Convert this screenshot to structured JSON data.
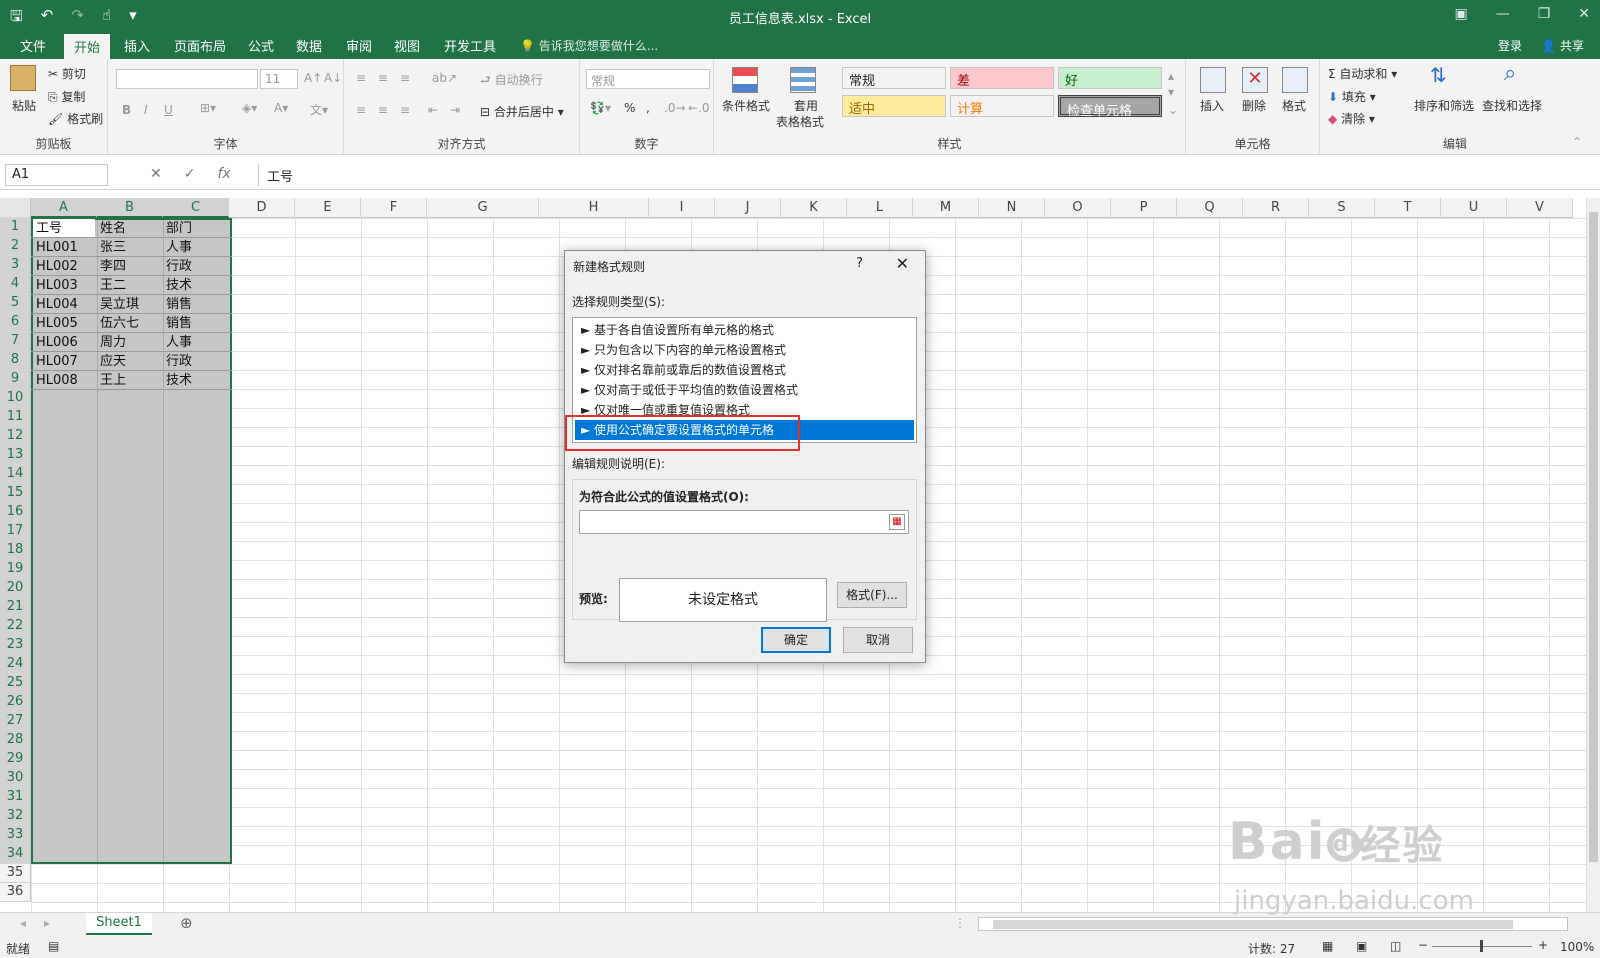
{
  "window": {
    "title": "员工信息表.xlsx - Excel"
  },
  "tabs": [
    "文件",
    "开始",
    "插入",
    "页面布局",
    "公式",
    "数据",
    "审阅",
    "视图",
    "开发工具"
  ],
  "tell_me": "告诉我您想要做什么...",
  "login": "登录",
  "share": "共享",
  "ribbon": {
    "clipboard": {
      "label": "剪贴板",
      "paste": "粘贴",
      "cut": "剪切",
      "copy": "复制",
      "format_painter": "格式刷"
    },
    "font": {
      "label": "字体",
      "size": "11",
      "bold": "B",
      "italic": "I",
      "underline": "U"
    },
    "alignment": {
      "label": "对齐方式",
      "wrap": "自动换行",
      "merge": "合并后居中"
    },
    "number": {
      "label": "数字",
      "format": "常规",
      "percent": "%",
      "comma": ","
    },
    "styles": {
      "label": "样式",
      "conditional": "条件格式",
      "table": "套用",
      "table2": "表格格式",
      "cells": [
        {
          "text": "常规",
          "bg": "#ffffff",
          "fg": "#222222"
        },
        {
          "text": "差",
          "bg": "#ffc7ce",
          "fg": "#9c0006"
        },
        {
          "text": "好",
          "bg": "#c6efce",
          "fg": "#006100"
        },
        {
          "text": "适中",
          "bg": "#ffeb9c",
          "fg": "#9c6500"
        },
        {
          "text": "计算",
          "bg": "#f2f2f2",
          "fg": "#fa7d00"
        },
        {
          "text": "检查单元格",
          "bg": "#a5a5a5",
          "fg": "#ffffff"
        }
      ]
    },
    "cells_group": {
      "label": "单元格",
      "insert": "插入",
      "delete": "删除",
      "format": "格式"
    },
    "editing": {
      "label": "编辑",
      "autosum": "自动求和",
      "fill": "填充",
      "clear": "清除",
      "sort": "排序和筛选",
      "find": "查找和选择"
    }
  },
  "formula_bar": {
    "name_box": "A1",
    "fx": "fx",
    "content": "工号"
  },
  "columns": [
    "A",
    "B",
    "C",
    "D",
    "E",
    "F",
    "G",
    "H",
    "I",
    "J",
    "K",
    "L",
    "M",
    "N",
    "O",
    "P",
    "Q",
    "R",
    "S",
    "T",
    "U",
    "V"
  ],
  "rows": [
    "1",
    "2",
    "3",
    "4",
    "5",
    "6",
    "7",
    "8",
    "9",
    "10",
    "11",
    "12",
    "13",
    "14",
    "15",
    "16",
    "17",
    "18",
    "19",
    "20",
    "21",
    "22",
    "23",
    "24",
    "25",
    "26",
    "27",
    "28",
    "29",
    "30",
    "31",
    "32",
    "33",
    "34",
    "35",
    "36"
  ],
  "table": [
    [
      "工号",
      "姓名",
      "部门"
    ],
    [
      "HL001",
      "张三",
      "人事"
    ],
    [
      "HL002",
      "李四",
      "行政"
    ],
    [
      "HL003",
      "王二",
      "技术"
    ],
    [
      "HL004",
      "吴立琪",
      "销售"
    ],
    [
      "HL005",
      "伍六七",
      "销售"
    ],
    [
      "HL006",
      "周力",
      "人事"
    ],
    [
      "HL007",
      "应天",
      "行政"
    ],
    [
      "HL008",
      "王上",
      "技术"
    ]
  ],
  "dialog": {
    "title": "新建格式规则",
    "help": "?",
    "select_label": "选择规则类型(S):",
    "rules": [
      "► 基于各自值设置所有单元格的格式",
      "► 只为包含以下内容的单元格设置格式",
      "► 仅对排名靠前或靠后的数值设置格式",
      "► 仅对高于或低于平均值的数值设置格式",
      "► 仅对唯一值或重复值设置格式",
      "► 使用公式确定要设置格式的单元格"
    ],
    "edit_label": "编辑规则说明(E):",
    "formula_label": "为符合此公式的值设置格式(O):",
    "formula_value": "",
    "preview_label": "预览:",
    "preview_text": "未设定格式",
    "format_button": "格式(F)...",
    "ok": "确定",
    "cancel": "取消"
  },
  "sheet": {
    "name": "Sheet1"
  },
  "status": {
    "ready": "就绪",
    "count": "计数: 27",
    "zoom": "100%"
  },
  "watermark": {
    "text1": "Bai",
    "text2": "du",
    "text3": "经验",
    "url": "jingyan.baidu.com"
  }
}
